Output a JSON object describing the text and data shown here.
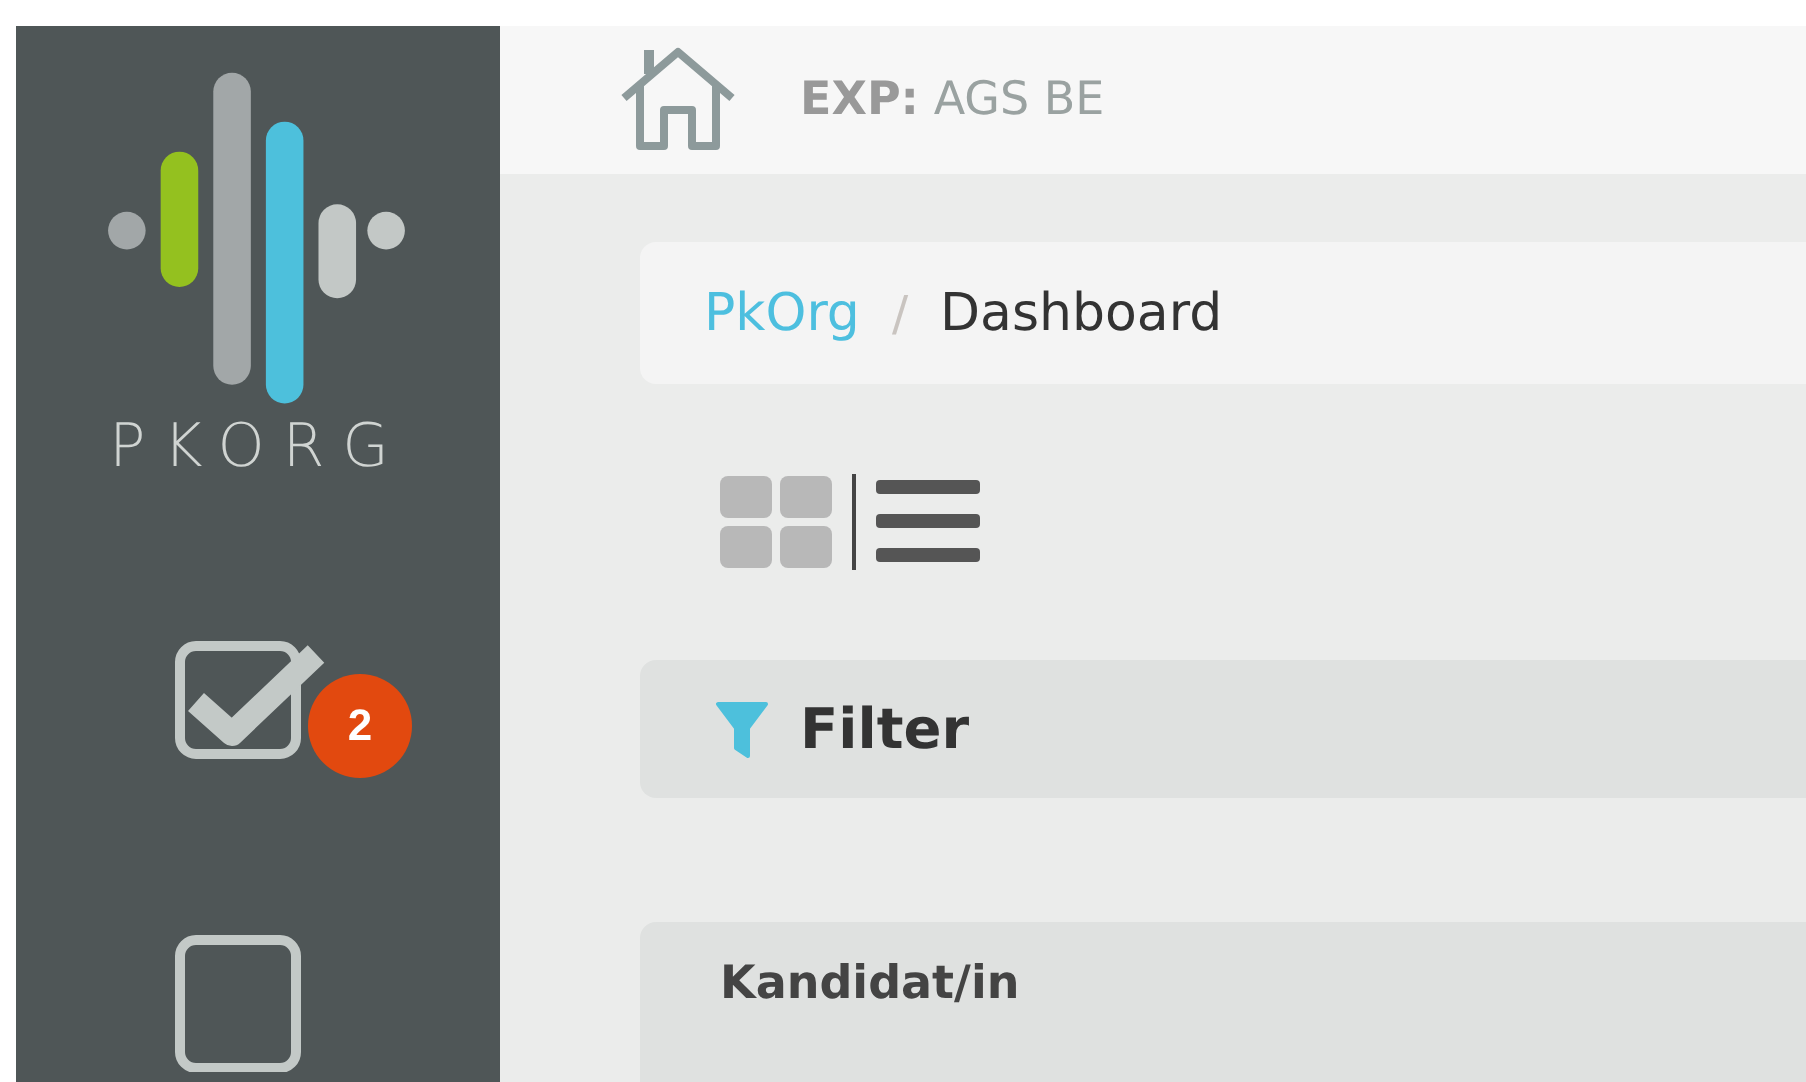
{
  "sidebar": {
    "logo_text": "PKORG",
    "items": [
      {
        "kind": "tasks",
        "badge": "2"
      },
      {
        "kind": "document"
      }
    ]
  },
  "topbar": {
    "label": "EXP:",
    "value": "AGS BE"
  },
  "breadcrumb_separator": "/",
  "breadcrumb": [
    {
      "label": "PkOrg",
      "kind": "link"
    },
    {
      "label": "Dashboard",
      "kind": "current"
    }
  ],
  "view_modes": [
    {
      "kind": "grid",
      "selected": false
    },
    {
      "kind": "list",
      "selected": true
    }
  ],
  "filter": {
    "label": "Filter"
  },
  "table": {
    "columns": [
      "Kandidat/in"
    ]
  }
}
